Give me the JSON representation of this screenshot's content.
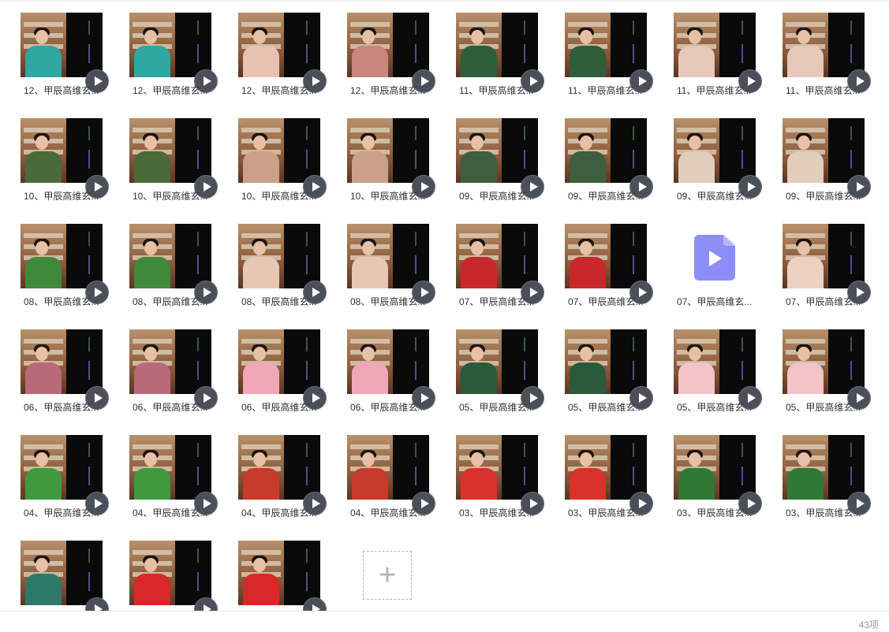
{
  "items": [
    {
      "caption": "12、甲辰高维玄...",
      "outfit": "#2ea8a0",
      "type": "video"
    },
    {
      "caption": "12、甲辰高维玄...",
      "outfit": "#2ea8a0",
      "type": "video"
    },
    {
      "caption": "12、甲辰高维玄...",
      "outfit": "#e8c2b0",
      "type": "video"
    },
    {
      "caption": "12、甲辰高维玄...",
      "outfit": "#c9867a",
      "type": "video"
    },
    {
      "caption": "11、甲辰高维玄...",
      "outfit": "#2f5e3a",
      "type": "video"
    },
    {
      "caption": "11、甲辰高维玄...",
      "outfit": "#2f5e3a",
      "type": "video"
    },
    {
      "caption": "11、甲辰高维玄...",
      "outfit": "#e6c8bb",
      "type": "video"
    },
    {
      "caption": "11、甲辰高维玄...",
      "outfit": "#e6c8bb",
      "type": "video"
    },
    {
      "caption": "10、甲辰高维玄...",
      "outfit": "#4a6a3a",
      "type": "video"
    },
    {
      "caption": "10、甲辰高维玄...",
      "outfit": "#4a6a3a",
      "type": "video"
    },
    {
      "caption": "10、甲辰高维玄...",
      "outfit": "#caa088",
      "type": "video"
    },
    {
      "caption": "10、甲辰高维玄...",
      "outfit": "#caa088",
      "type": "video"
    },
    {
      "caption": "09、甲辰高维玄...",
      "outfit": "#3e5e3e",
      "type": "video"
    },
    {
      "caption": "09、甲辰高维玄...",
      "outfit": "#3e5e3e",
      "type": "video"
    },
    {
      "caption": "09、甲辰高维玄...",
      "outfit": "#e2cdbb",
      "type": "video"
    },
    {
      "caption": "09、甲辰高维玄...",
      "outfit": "#e2cdbb",
      "type": "video"
    },
    {
      "caption": "08、甲辰高维玄...",
      "outfit": "#3f8a3a",
      "type": "video"
    },
    {
      "caption": "08、甲辰高维玄...",
      "outfit": "#3f8a3a",
      "type": "video"
    },
    {
      "caption": "08、甲辰高维玄...",
      "outfit": "#e8c6b4",
      "type": "video"
    },
    {
      "caption": "08、甲辰高维玄...",
      "outfit": "#e8c6b4",
      "type": "video"
    },
    {
      "caption": "07、甲辰高维玄...",
      "outfit": "#c8282a",
      "type": "video"
    },
    {
      "caption": "07、甲辰高维玄...",
      "outfit": "#c8282a",
      "type": "video"
    },
    {
      "caption": "07、甲辰高维玄...",
      "outfit": "",
      "type": "file"
    },
    {
      "caption": "07、甲辰高维玄...",
      "outfit": "#ecd0c2",
      "type": "video"
    },
    {
      "caption": "06、甲辰高维玄...",
      "outfit": "#b86a78",
      "type": "video"
    },
    {
      "caption": "06、甲辰高维玄...",
      "outfit": "#b86a78",
      "type": "video"
    },
    {
      "caption": "06、甲辰高维玄...",
      "outfit": "#f0a8b8",
      "type": "video"
    },
    {
      "caption": "06、甲辰高维玄...",
      "outfit": "#f0a8b8",
      "type": "video"
    },
    {
      "caption": "05、甲辰高维玄...",
      "outfit": "#2a5a3a",
      "type": "video"
    },
    {
      "caption": "05、甲辰高维玄...",
      "outfit": "#2a5a3a",
      "type": "video"
    },
    {
      "caption": "05、甲辰高维玄...",
      "outfit": "#f2c4c8",
      "type": "video"
    },
    {
      "caption": "05、甲辰高维玄...",
      "outfit": "#f2c4c8",
      "type": "video"
    },
    {
      "caption": "04、甲辰高维玄...",
      "outfit": "#3f9a3e",
      "type": "video"
    },
    {
      "caption": "04、甲辰高维玄...",
      "outfit": "#3f9a3e",
      "type": "video"
    },
    {
      "caption": "04、甲辰高维玄...",
      "outfit": "#c83a2a",
      "type": "video"
    },
    {
      "caption": "04、甲辰高维玄...",
      "outfit": "#c83a2a",
      "type": "video"
    },
    {
      "caption": "03、甲辰高维玄...",
      "outfit": "#d8322a",
      "type": "video"
    },
    {
      "caption": "03、甲辰高维玄...",
      "outfit": "#d8322a",
      "type": "video"
    },
    {
      "caption": "03、甲辰高维玄...",
      "outfit": "#2e7a34",
      "type": "video"
    },
    {
      "caption": "03、甲辰高维玄...",
      "outfit": "#2e7a34",
      "type": "video"
    },
    {
      "caption": "",
      "outfit": "#2e7a6a",
      "type": "video"
    },
    {
      "caption": "",
      "outfit": "#d8282a",
      "type": "video"
    },
    {
      "caption": "",
      "outfit": "#d8282a",
      "type": "video"
    }
  ],
  "add_button": {
    "icon": "plus-icon",
    "label": "+"
  },
  "status": {
    "item_count": "43项"
  },
  "colors": {
    "play_button": "#4b4f5a",
    "file_icon": "#8d8df7",
    "background": "#ffffff"
  }
}
